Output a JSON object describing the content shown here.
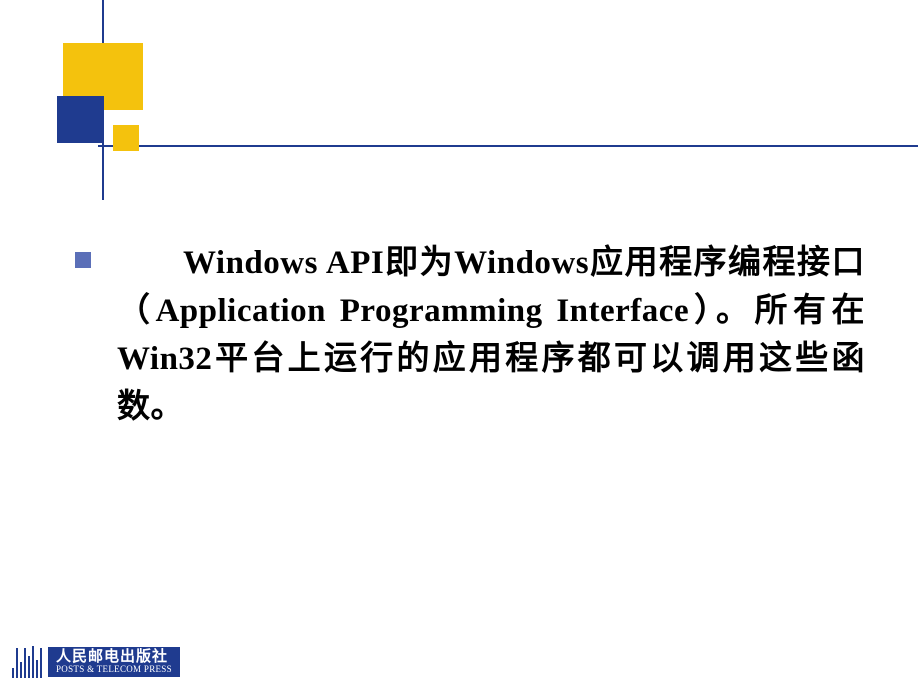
{
  "body": {
    "text": "Windows API即为Windows应用程序编程接口（Application Programming Interface）。所有在Win32平台上运行的应用程序都可以调用这些函数。"
  },
  "footer": {
    "publisher_cn": "人民邮电出版社",
    "publisher_en": "POSTS & TELECOM PRESS"
  }
}
